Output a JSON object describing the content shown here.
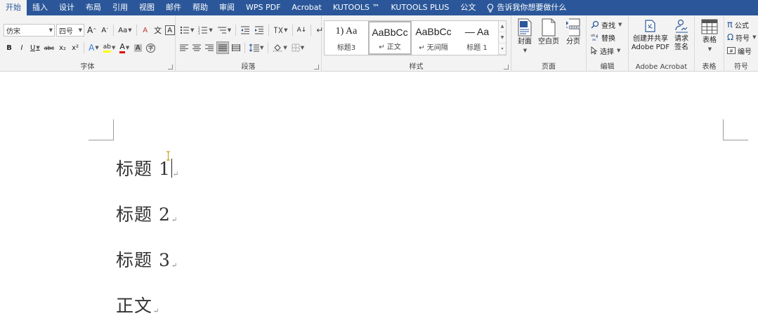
{
  "tabs": [
    "开始",
    "插入",
    "设计",
    "布局",
    "引用",
    "视图",
    "邮件",
    "帮助",
    "审阅",
    "WPS PDF",
    "Acrobat",
    "KUTOOLS ™",
    "KUTOOLS PLUS",
    "公文"
  ],
  "tell_me": "告诉我你想要做什么",
  "font": {
    "label": "字体",
    "name": "仿宋",
    "size": "四号",
    "grow": "A",
    "shrink": "A",
    "case": "Aa",
    "clear": "A",
    "phonetic": "文",
    "border_char": "A",
    "bold": "B",
    "italic": "I",
    "underline": "U",
    "strike": "abc",
    "sub": "x₂",
    "sup": "x²",
    "effects": "A",
    "highlight": "ab",
    "color": "A",
    "shade": "A",
    "enclose": "字"
  },
  "paragraph": {
    "label": "段落",
    "sort": "A↓",
    "marks": "↵"
  },
  "styles": {
    "label": "样式",
    "items": [
      {
        "sample": "1)   Aa",
        "name": "标题3"
      },
      {
        "sample": "AaBbCc",
        "name": "↵ 正文"
      },
      {
        "sample": "AaBbCc",
        "name": "↵ 无间隔"
      },
      {
        "sample": "—   Aa",
        "name": "标题 1"
      }
    ]
  },
  "pages": {
    "label": "页面",
    "cover": "封面",
    "blank": "空白页",
    "break": "分页"
  },
  "editing": {
    "label": "编辑",
    "find": "查找",
    "replace": "替换",
    "select": "选择"
  },
  "acrobat": {
    "label": "Adobe Acrobat",
    "create_line1": "创建并共享",
    "create_line2": "Adobe PDF",
    "sign_line1": "请求",
    "sign_line2": "签名"
  },
  "table": {
    "label": "表格",
    "button": "表格"
  },
  "symbols": {
    "label": "符号",
    "formula": "公式",
    "symbol": "符号",
    "numbering": "编号"
  },
  "document": {
    "paragraphs": [
      {
        "text": "标题 1"
      },
      {
        "text": "标题 2"
      },
      {
        "text": "标题 3"
      },
      {
        "text": "正文"
      }
    ],
    "paragraph_mark": "↵"
  },
  "colors": {
    "tabbar": "#2b579a",
    "ribbon": "#f3f3f3",
    "highlight": "#ffff00",
    "font_color": "#e00000",
    "icon_blue": "#2b579a"
  }
}
